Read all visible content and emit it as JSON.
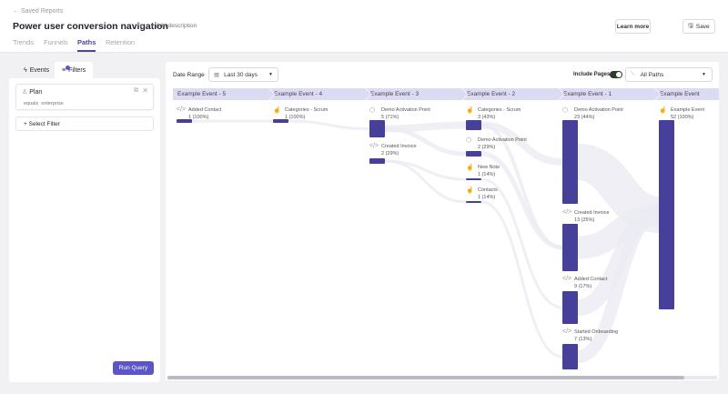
{
  "header": {
    "back_label": "Saved Reports",
    "title": "Power user conversion navigation",
    "add_description": "Add description",
    "learn_more": "Learn more",
    "save": "Save"
  },
  "tabs": [
    {
      "label": "Trends"
    },
    {
      "label": "Funnels"
    },
    {
      "label": "Paths",
      "active": true
    },
    {
      "label": "Retention"
    }
  ],
  "left_panel": {
    "tabs": [
      {
        "label": "Events"
      },
      {
        "label": "Filters",
        "active": true
      }
    ],
    "filter": {
      "property": "Plan",
      "operator": "equals",
      "value": "enterprise"
    },
    "select_filter": "Select Filter",
    "run_query": "Run Query"
  },
  "controls": {
    "date_range_label": "Date Range",
    "date_range_value": "Last 30 days",
    "include_pages_label": "Include Pages",
    "include_pages_on": true,
    "paths_value": "All Paths"
  },
  "colors": {
    "accent": "#46409a",
    "header_bg": "#dcdbf4",
    "button": "#5b55c8"
  },
  "columns": [
    {
      "title": "Example Event - 5",
      "nodes": [
        {
          "name": "Added Contact",
          "stat": "1 (100%)",
          "icon": "code-icon"
        }
      ]
    },
    {
      "title": "Example Event - 4",
      "nodes": [
        {
          "name": "Categories - Scrum",
          "stat": "1 (100%)",
          "icon": "click-icon"
        }
      ]
    },
    {
      "title": "Example Event - 3",
      "nodes": [
        {
          "name": "Demo Activation Point",
          "stat": "5 (71%)",
          "icon": "cube-icon"
        },
        {
          "name": "Created Invoice",
          "stat": "2 (29%)",
          "icon": "code-icon"
        }
      ]
    },
    {
      "title": "Example Event - 2",
      "nodes": [
        {
          "name": "Categories - Scrum",
          "stat": "3 (43%)",
          "icon": "click-icon"
        },
        {
          "name": "Demo Activation Point",
          "stat": "2 (29%)",
          "icon": "cube-icon"
        },
        {
          "name": "New Note",
          "stat": "1 (14%)",
          "icon": "click-icon"
        },
        {
          "name": "Contacts",
          "stat": "1 (14%)",
          "icon": "click-icon"
        }
      ]
    },
    {
      "title": "Example Event - 1",
      "nodes": [
        {
          "name": "Demo Activation Point",
          "stat": "23 (44%)",
          "icon": "cube-icon"
        },
        {
          "name": "Created Invoice",
          "stat": "13 (25%)",
          "icon": "code-icon"
        },
        {
          "name": "Added Contact",
          "stat": "9 (17%)",
          "icon": "code-icon"
        },
        {
          "name": "Started Onboarding",
          "stat": "7 (13%)",
          "icon": "code-icon"
        }
      ]
    },
    {
      "title": "Example Event",
      "nodes": [
        {
          "name": "Example Event",
          "stat": "52 (100%)",
          "icon": "click-icon"
        }
      ]
    }
  ]
}
